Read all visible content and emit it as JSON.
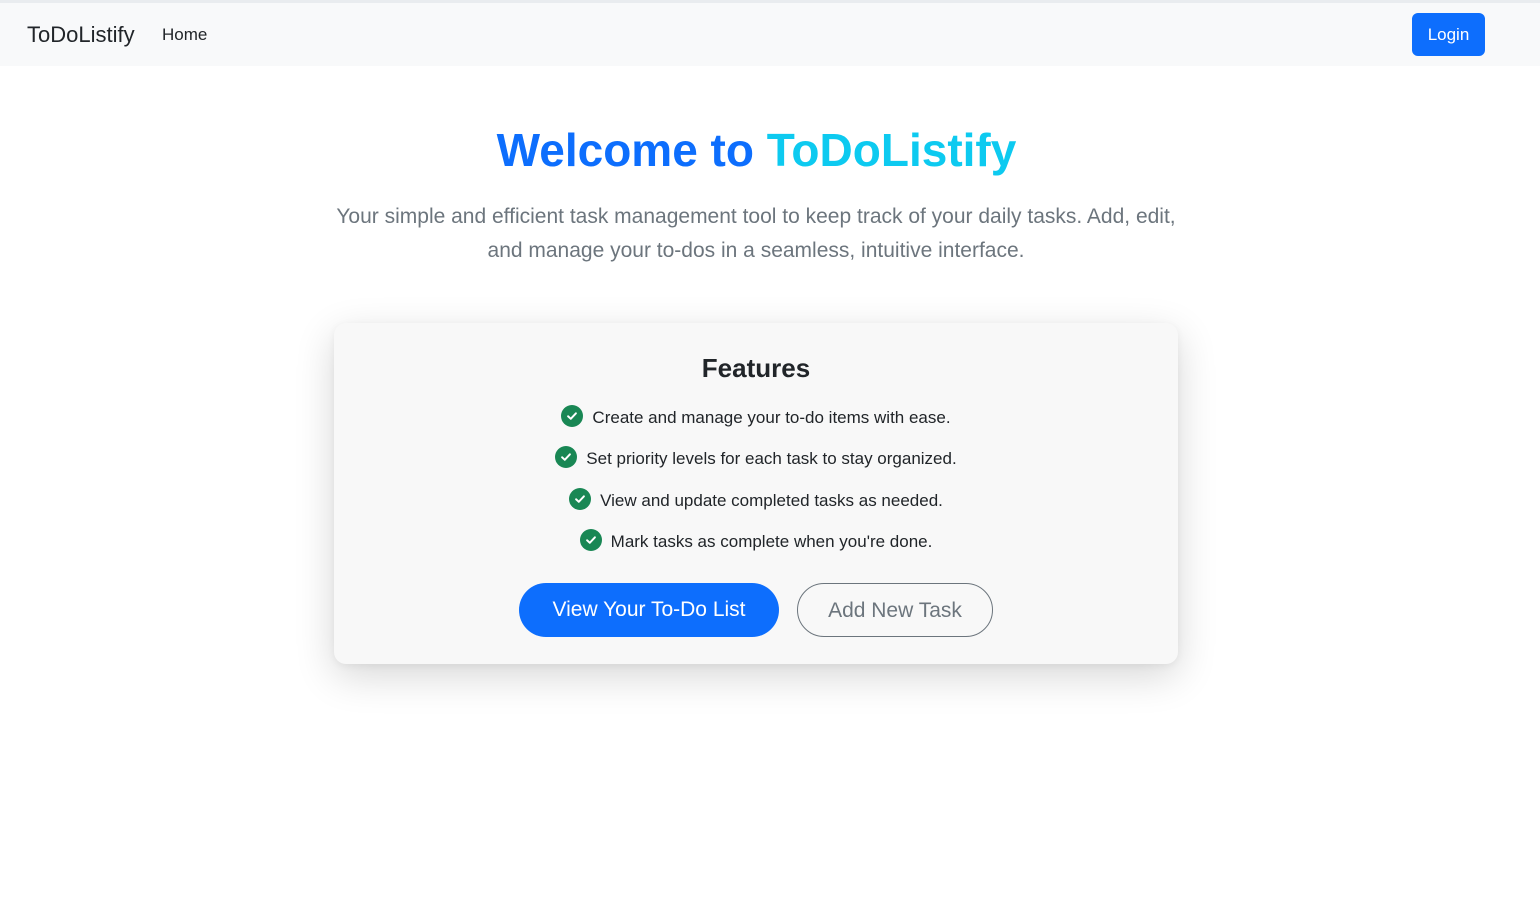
{
  "navbar": {
    "brand": "ToDoListify",
    "links": [
      {
        "label": "Home"
      }
    ],
    "login_label": "Login"
  },
  "hero": {
    "title_part1": "Welcome to",
    "title_part2": "ToDoListify",
    "subtitle": "Your simple and efficient task management tool to keep track of your daily tasks. Add, edit, and manage your to-dos in a seamless, intuitive interface."
  },
  "features": {
    "title": "Features",
    "items": [
      {
        "icon": "check-circle-icon",
        "text": "Create and manage your to-do items with ease."
      },
      {
        "icon": "check-circle-icon",
        "text": "Set priority levels for each task to stay organized."
      },
      {
        "icon": "check-circle-icon",
        "text": "View and update completed tasks as needed."
      },
      {
        "icon": "check-circle-icon",
        "text": "Mark tasks as complete when you're done."
      }
    ],
    "primary_button": "View Your To-Do List",
    "secondary_button": "Add New Task"
  },
  "colors": {
    "primary": "#0d6efd",
    "accent": "#0dcaf0",
    "success": "#198754",
    "muted": "#6c757d",
    "navbar_bg": "#f8f9fa"
  }
}
